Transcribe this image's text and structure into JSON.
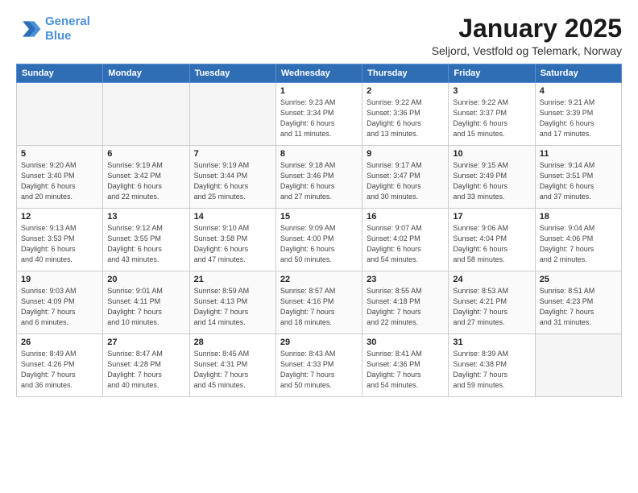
{
  "header": {
    "logo_line1": "General",
    "logo_line2": "Blue",
    "month": "January 2025",
    "location": "Seljord, Vestfold og Telemark, Norway"
  },
  "weekdays": [
    "Sunday",
    "Monday",
    "Tuesday",
    "Wednesday",
    "Thursday",
    "Friday",
    "Saturday"
  ],
  "weeks": [
    [
      {
        "day": "",
        "info": ""
      },
      {
        "day": "",
        "info": ""
      },
      {
        "day": "",
        "info": ""
      },
      {
        "day": "1",
        "info": "Sunrise: 9:23 AM\nSunset: 3:34 PM\nDaylight: 6 hours\nand 11 minutes."
      },
      {
        "day": "2",
        "info": "Sunrise: 9:22 AM\nSunset: 3:36 PM\nDaylight: 6 hours\nand 13 minutes."
      },
      {
        "day": "3",
        "info": "Sunrise: 9:22 AM\nSunset: 3:37 PM\nDaylight: 6 hours\nand 15 minutes."
      },
      {
        "day": "4",
        "info": "Sunrise: 9:21 AM\nSunset: 3:39 PM\nDaylight: 6 hours\nand 17 minutes."
      }
    ],
    [
      {
        "day": "5",
        "info": "Sunrise: 9:20 AM\nSunset: 3:40 PM\nDaylight: 6 hours\nand 20 minutes."
      },
      {
        "day": "6",
        "info": "Sunrise: 9:19 AM\nSunset: 3:42 PM\nDaylight: 6 hours\nand 22 minutes."
      },
      {
        "day": "7",
        "info": "Sunrise: 9:19 AM\nSunset: 3:44 PM\nDaylight: 6 hours\nand 25 minutes."
      },
      {
        "day": "8",
        "info": "Sunrise: 9:18 AM\nSunset: 3:46 PM\nDaylight: 6 hours\nand 27 minutes."
      },
      {
        "day": "9",
        "info": "Sunrise: 9:17 AM\nSunset: 3:47 PM\nDaylight: 6 hours\nand 30 minutes."
      },
      {
        "day": "10",
        "info": "Sunrise: 9:15 AM\nSunset: 3:49 PM\nDaylight: 6 hours\nand 33 minutes."
      },
      {
        "day": "11",
        "info": "Sunrise: 9:14 AM\nSunset: 3:51 PM\nDaylight: 6 hours\nand 37 minutes."
      }
    ],
    [
      {
        "day": "12",
        "info": "Sunrise: 9:13 AM\nSunset: 3:53 PM\nDaylight: 6 hours\nand 40 minutes."
      },
      {
        "day": "13",
        "info": "Sunrise: 9:12 AM\nSunset: 3:55 PM\nDaylight: 6 hours\nand 43 minutes."
      },
      {
        "day": "14",
        "info": "Sunrise: 9:10 AM\nSunset: 3:58 PM\nDaylight: 6 hours\nand 47 minutes."
      },
      {
        "day": "15",
        "info": "Sunrise: 9:09 AM\nSunset: 4:00 PM\nDaylight: 6 hours\nand 50 minutes."
      },
      {
        "day": "16",
        "info": "Sunrise: 9:07 AM\nSunset: 4:02 PM\nDaylight: 6 hours\nand 54 minutes."
      },
      {
        "day": "17",
        "info": "Sunrise: 9:06 AM\nSunset: 4:04 PM\nDaylight: 6 hours\nand 58 minutes."
      },
      {
        "day": "18",
        "info": "Sunrise: 9:04 AM\nSunset: 4:06 PM\nDaylight: 7 hours\nand 2 minutes."
      }
    ],
    [
      {
        "day": "19",
        "info": "Sunrise: 9:03 AM\nSunset: 4:09 PM\nDaylight: 7 hours\nand 6 minutes."
      },
      {
        "day": "20",
        "info": "Sunrise: 9:01 AM\nSunset: 4:11 PM\nDaylight: 7 hours\nand 10 minutes."
      },
      {
        "day": "21",
        "info": "Sunrise: 8:59 AM\nSunset: 4:13 PM\nDaylight: 7 hours\nand 14 minutes."
      },
      {
        "day": "22",
        "info": "Sunrise: 8:57 AM\nSunset: 4:16 PM\nDaylight: 7 hours\nand 18 minutes."
      },
      {
        "day": "23",
        "info": "Sunrise: 8:55 AM\nSunset: 4:18 PM\nDaylight: 7 hours\nand 22 minutes."
      },
      {
        "day": "24",
        "info": "Sunrise: 8:53 AM\nSunset: 4:21 PM\nDaylight: 7 hours\nand 27 minutes."
      },
      {
        "day": "25",
        "info": "Sunrise: 8:51 AM\nSunset: 4:23 PM\nDaylight: 7 hours\nand 31 minutes."
      }
    ],
    [
      {
        "day": "26",
        "info": "Sunrise: 8:49 AM\nSunset: 4:26 PM\nDaylight: 7 hours\nand 36 minutes."
      },
      {
        "day": "27",
        "info": "Sunrise: 8:47 AM\nSunset: 4:28 PM\nDaylight: 7 hours\nand 40 minutes."
      },
      {
        "day": "28",
        "info": "Sunrise: 8:45 AM\nSunset: 4:31 PM\nDaylight: 7 hours\nand 45 minutes."
      },
      {
        "day": "29",
        "info": "Sunrise: 8:43 AM\nSunset: 4:33 PM\nDaylight: 7 hours\nand 50 minutes."
      },
      {
        "day": "30",
        "info": "Sunrise: 8:41 AM\nSunset: 4:36 PM\nDaylight: 7 hours\nand 54 minutes."
      },
      {
        "day": "31",
        "info": "Sunrise: 8:39 AM\nSunset: 4:38 PM\nDaylight: 7 hours\nand 59 minutes."
      },
      {
        "day": "",
        "info": ""
      }
    ]
  ]
}
